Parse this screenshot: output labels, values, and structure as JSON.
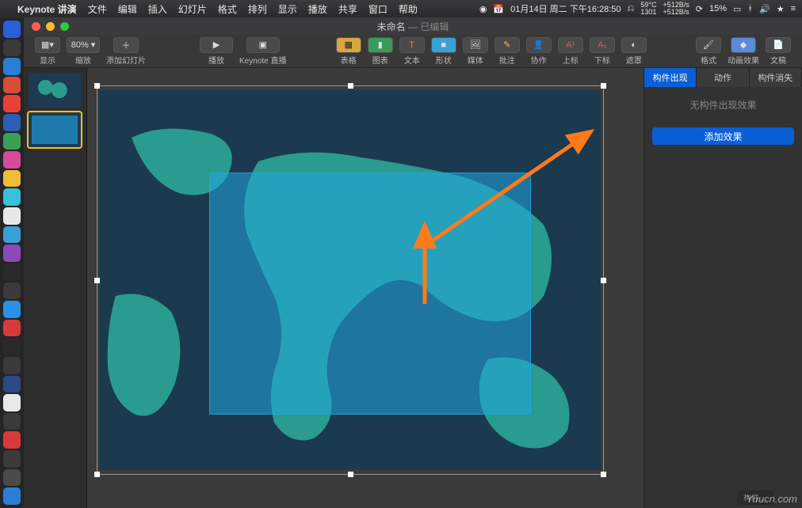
{
  "menubar": {
    "app": "Keynote 讲演",
    "items": [
      "文件",
      "编辑",
      "插入",
      "幻灯片",
      "格式",
      "排列",
      "显示",
      "播放",
      "共享",
      "窗口",
      "帮助"
    ],
    "date": "01月14日 周二 下午16:28:50",
    "cpu_temp": "59°C",
    "ram": "1301",
    "net_up": "+512B/s",
    "net_down": "+512B/s",
    "battery": "15%"
  },
  "window": {
    "title": "未命名",
    "subtitle": "— 已编辑"
  },
  "toolbar": {
    "view": "显示",
    "zoom": "80% ▾",
    "zoom_label": "缩放",
    "add_slide": "添加幻灯片",
    "play": "播放",
    "live": "Keynote 直播",
    "table": "表格",
    "chart": "图表",
    "text": "文本",
    "shape": "形状",
    "media": "媒体",
    "annotate": "批注",
    "collab": "协作",
    "upper": "上标",
    "lower": "下标",
    "mask": "遮罩",
    "format": "格式",
    "animate": "动画效果",
    "document": "文稿"
  },
  "inspector": {
    "top_tabs": {
      "format": "格式",
      "animate": "动画效果",
      "document": "文稿"
    },
    "tabs": {
      "build_in": "构件出现",
      "action": "动作",
      "build_out": "构件消失"
    },
    "empty_msg": "无构件出现效果",
    "add_effect": "添加效果",
    "bottom_label": "构件…"
  },
  "watermark": "Yuucn.com"
}
